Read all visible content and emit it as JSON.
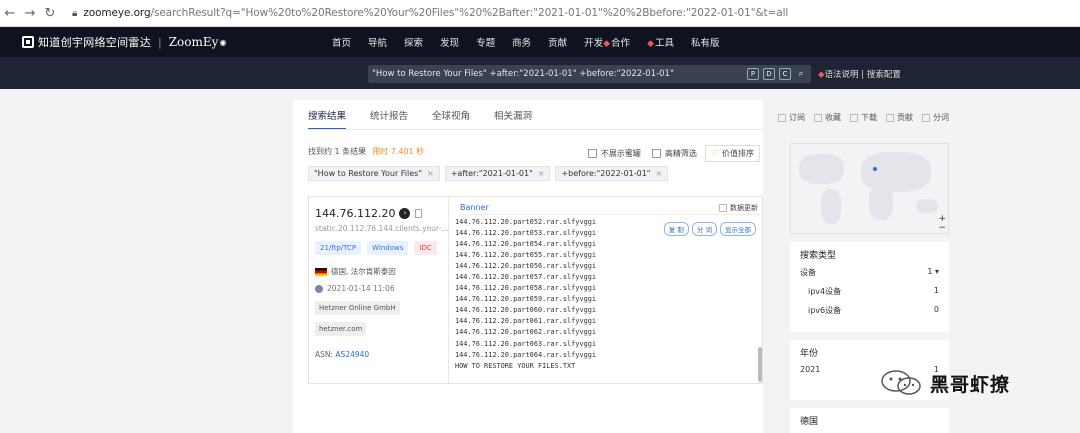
{
  "browser": {
    "url_host": "zoomeye.org",
    "url_path": "/searchResult?q=\"How%20to%20Restore%20Your%20Files\"%20%2Bafter:\"2021-01-01\"%20%2Bbefore:\"2022-01-01\"&t=all"
  },
  "nav": {
    "brand_cn": "知道创宇网络空间雷达",
    "brand_sep": "|",
    "brand_en": "ZoomEy",
    "menu": [
      "首页",
      "导航",
      "探索",
      "发现",
      "专题",
      "商务",
      "贡献",
      "开发"
    ],
    "menu_coop": "合作",
    "menu_tools": "工具",
    "menu_private": "私有版"
  },
  "search": {
    "query": "\"How to Restore Your Files\" +after:\"2021-01-01\" +before:\"2022-01-01\"",
    "icons": [
      "P",
      "D",
      "C"
    ],
    "help": "语法说明 | 搜索配置"
  },
  "tabs": [
    "搜索结果",
    "统计报告",
    "全球视角",
    "相关漏洞"
  ],
  "actions": [
    "订阅",
    "收藏",
    "下载",
    "贡献",
    "分词"
  ],
  "result_info": {
    "count_text": "找到约 1 条结果",
    "time_text": "用时 7.401 秒"
  },
  "filters": {
    "no_honeypot": "不展示蜜罐",
    "hq": "高精筛选",
    "sort": "价值排序"
  },
  "chips": [
    "\"How to Restore Your Files\"",
    "+after:\"2021-01-01\"",
    "+before:\"2022-01-01\""
  ],
  "result": {
    "ip": "144.76.112.20",
    "hostname": "static.20.112.76.144.clients.your-...",
    "tags": [
      "21/ftp/TCP",
      "Windows",
      "IDC"
    ],
    "geo": "德国, 法尔肯斯泰因",
    "date": "2021-01-14 11:06",
    "org": "Hetzner Online GmbH",
    "domain": "hetzner.com",
    "asn_label": "ASN:",
    "asn": "AS24940",
    "banner_title": "Banner",
    "refresh": "数据更新",
    "banner_actions": [
      "复 制",
      "分 词",
      "显示全部"
    ],
    "banner_lines": [
      "144.76.112.20.part052.rar.slfyvggi",
      "144.76.112.20.part053.rar.slfyvggi",
      "144.76.112.20.part054.rar.slfyvggi",
      "144.76.112.20.part055.rar.slfyvggi",
      "144.76.112.20.part056.rar.slfyvggi",
      "144.76.112.20.part057.rar.slfyvggi",
      "144.76.112.20.part058.rar.slfyvggi",
      "144.76.112.20.part059.rar.slfyvggi",
      "144.76.112.20.part060.rar.slfyvggi",
      "144.76.112.20.part061.rar.slfyvggi",
      "144.76.112.20.part062.rar.slfyvggi",
      "144.76.112.20.part063.rar.slfyvggi",
      "144.76.112.20.part064.rar.slfyvggi",
      "HOW TO RESTORE YOUR FILES.TXT"
    ]
  },
  "side": {
    "type_title": "搜索类型",
    "device_label": "设备",
    "device_count": "1",
    "ipv4_label": "ipv4设备",
    "ipv4_count": "1",
    "ipv6_label": "ipv6设备",
    "ipv6_count": "0",
    "year_title": "年份",
    "year_label": "2021",
    "year_count": "1",
    "country_title": "德国"
  },
  "watermark": "黑哥虾撩",
  "colors": {
    "accent": "#2b6bd6",
    "nav_bg": "#0f1320",
    "search_band": "#1e2433",
    "time": "#f28b1b"
  }
}
